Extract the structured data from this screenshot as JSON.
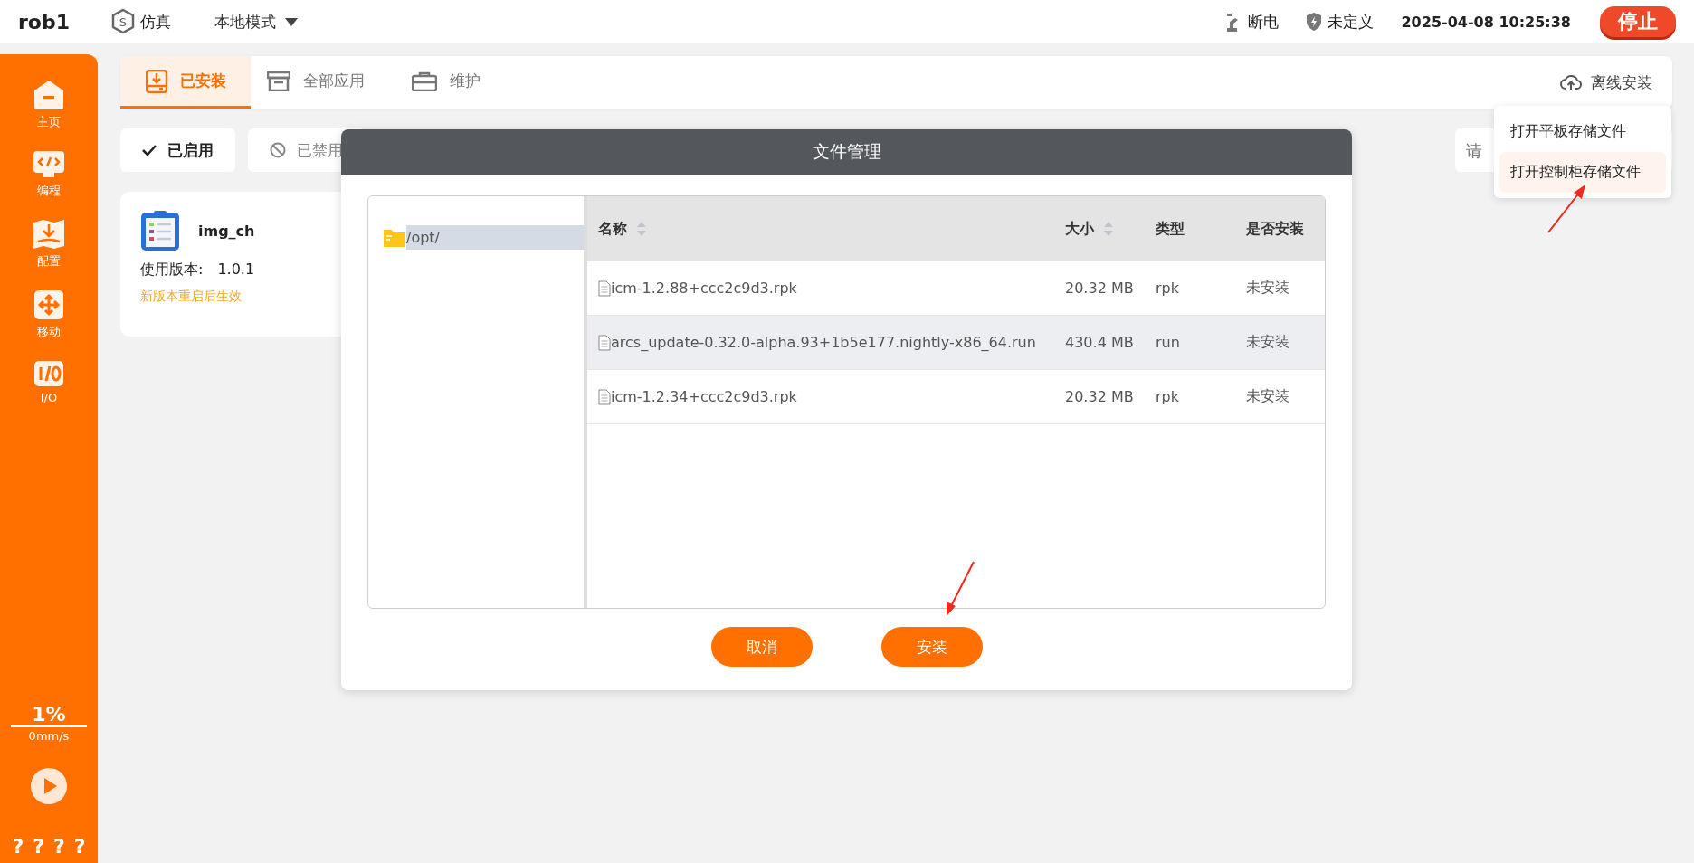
{
  "top_bar": {
    "robot_name": "rob1",
    "sim_icon_letter": "S",
    "sim_label": "仿真",
    "mode": "本地模式",
    "power": "断电",
    "safety": "未定义",
    "datetime": "2025-04-08 10:25:38",
    "stop_button": "停止"
  },
  "sidebar": {
    "items": [
      {
        "label": "主页",
        "kind": "home"
      },
      {
        "label": "编程",
        "kind": "code"
      },
      {
        "label": "配置",
        "kind": "config"
      },
      {
        "label": "移动",
        "kind": "move"
      },
      {
        "label": "I/O",
        "kind": "io"
      }
    ],
    "speed_percent": "1%",
    "speed": "0mm/s",
    "help_marks": [
      "?",
      "?",
      "?",
      "?"
    ]
  },
  "tabs": [
    {
      "label": "已安装",
      "kind": "installed",
      "selected": true
    },
    {
      "label": "全部应用",
      "kind": "all",
      "selected": false
    },
    {
      "label": "维护",
      "kind": "maintain",
      "selected": false
    }
  ],
  "offline_install": "离线安装",
  "filters": [
    {
      "label": "已启用",
      "kind": "enabled",
      "selected": true
    },
    {
      "label": "已禁用",
      "kind": "disabled",
      "selected": false
    }
  ],
  "search": {
    "placeholder": "请"
  },
  "app_card": {
    "name": "img_ch",
    "version_label": "使用版本:",
    "version": "1.0.1",
    "note": "新版本重启后生效"
  },
  "dropdown": [
    {
      "label": "打开平板存储文件",
      "selected": false
    },
    {
      "label": "打开控制柜存储文件",
      "selected": true
    }
  ],
  "dialog": {
    "title": "文件管理",
    "tree": [
      {
        "label": "/opt/",
        "selected": true
      }
    ],
    "columns": [
      {
        "label": "名称",
        "sortable": true
      },
      {
        "label": "大小",
        "sortable": true
      },
      {
        "label": "类型",
        "sortable": false
      },
      {
        "label": "是否安装",
        "sortable": false
      }
    ],
    "rows": [
      {
        "name": "icm-1.2.88+ccc2c9d3.rpk",
        "size": "20.32 MB",
        "type": "rpk",
        "installed": "未安装",
        "selected": false
      },
      {
        "name": "arcs_update-0.32.0-alpha.93+1b5e177.nightly-x86_64.run",
        "size": "430.4 MB",
        "type": "run",
        "installed": "未安装",
        "selected": true
      },
      {
        "name": "icm-1.2.34+ccc2c9d3.rpk",
        "size": "20.32 MB",
        "type": "rpk",
        "installed": "未安装",
        "selected": false
      }
    ],
    "buttons": [
      "取消",
      "安装"
    ]
  }
}
